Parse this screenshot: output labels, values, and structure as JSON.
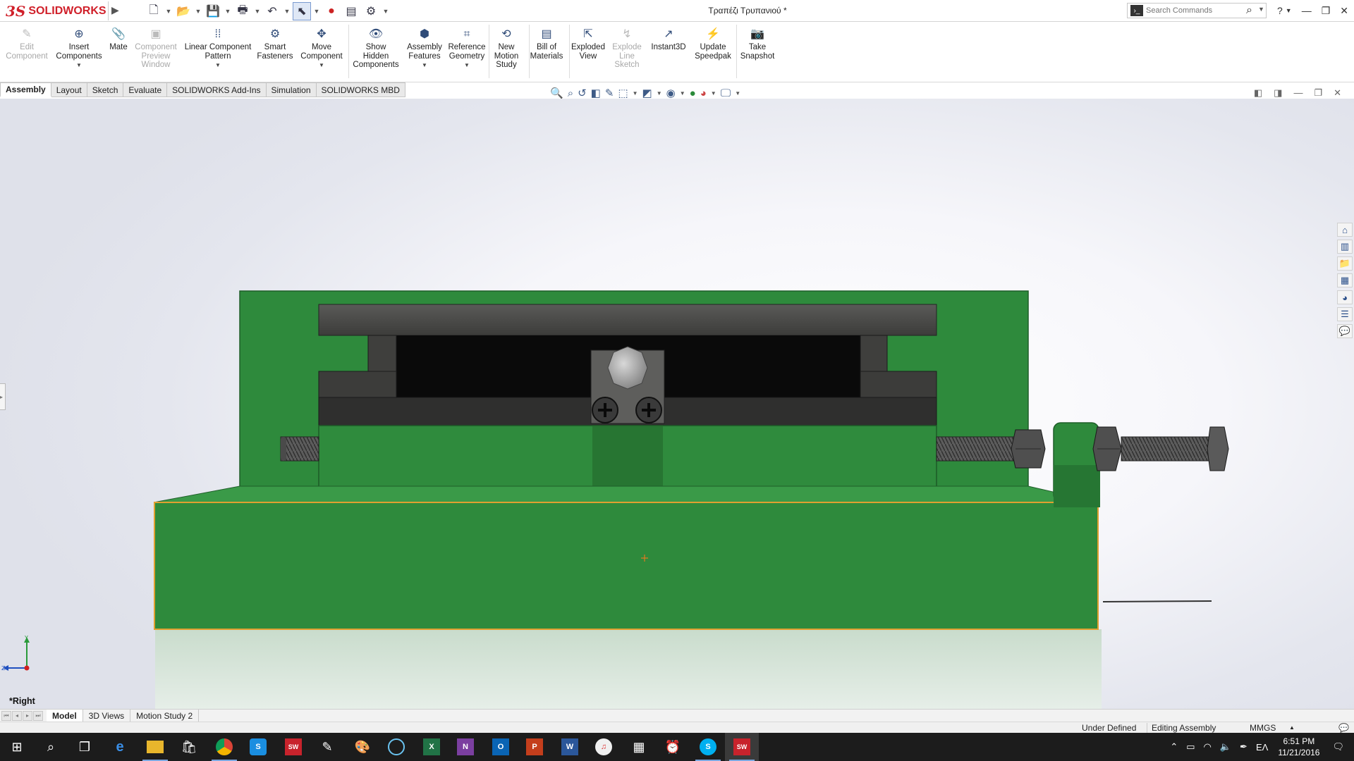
{
  "app": {
    "logo_ds": "3S",
    "logo_text": "SOLIDWORKS",
    "document_title": "Τραπέζι Τρυπανιού *"
  },
  "quick_access": {
    "icons": [
      "new-document-icon",
      "open-icon",
      "save-icon",
      "print-icon",
      "undo-icon",
      "select-icon",
      "rebuild-icon",
      "file-properties-icon",
      "options-icon"
    ]
  },
  "search": {
    "placeholder": "Search Commands"
  },
  "ribbon": {
    "commands": [
      {
        "id": "edit-component",
        "label": "Edit\nComponent",
        "enabled": false,
        "icon": "edit-component-icon",
        "dropdown": false
      },
      {
        "id": "insert-components",
        "label": "Insert\nComponents",
        "enabled": true,
        "icon": "insert-components-icon",
        "dropdown": true
      },
      {
        "id": "mate",
        "label": "Mate",
        "enabled": true,
        "icon": "paperclip-icon",
        "dropdown": false
      },
      {
        "id": "component-preview-window",
        "label": "Component\nPreview\nWindow",
        "enabled": false,
        "icon": "preview-window-icon",
        "dropdown": false
      },
      {
        "id": "linear-component-pattern",
        "label": "Linear Component\nPattern",
        "enabled": true,
        "icon": "linear-pattern-icon",
        "dropdown": true
      },
      {
        "id": "smart-fasteners",
        "label": "Smart\nFasteners",
        "enabled": true,
        "icon": "smart-fasteners-icon",
        "dropdown": false
      },
      {
        "id": "move-component",
        "label": "Move\nComponent",
        "enabled": true,
        "icon": "move-component-icon",
        "dropdown": true
      },
      {
        "id": "show-hidden-components",
        "label": "Show\nHidden\nComponents",
        "enabled": true,
        "icon": "show-hidden-icon",
        "dropdown": false
      },
      {
        "id": "assembly-features",
        "label": "Assembly\nFeatures",
        "enabled": true,
        "icon": "assembly-features-icon",
        "dropdown": true
      },
      {
        "id": "reference-geometry",
        "label": "Reference\nGeometry",
        "enabled": true,
        "icon": "reference-geometry-icon",
        "dropdown": true
      },
      {
        "id": "new-motion-study",
        "label": "New\nMotion\nStudy",
        "enabled": true,
        "icon": "motion-study-icon",
        "dropdown": false
      },
      {
        "id": "bill-of-materials",
        "label": "Bill of\nMaterials",
        "enabled": true,
        "icon": "bill-of-materials-icon",
        "dropdown": false
      },
      {
        "id": "exploded-view",
        "label": "Exploded\nView",
        "enabled": true,
        "icon": "exploded-view-icon",
        "dropdown": false
      },
      {
        "id": "explode-line-sketch",
        "label": "Explode\nLine\nSketch",
        "enabled": false,
        "icon": "explode-line-icon",
        "dropdown": false
      },
      {
        "id": "instant3d",
        "label": "Instant3D",
        "enabled": true,
        "icon": "instant3d-icon",
        "dropdown": false
      },
      {
        "id": "update-speedpak",
        "label": "Update\nSpeedpak",
        "enabled": true,
        "icon": "speedpak-icon",
        "dropdown": false
      },
      {
        "id": "take-snapshot",
        "label": "Take\nSnapshot",
        "enabled": true,
        "icon": "camera-icon",
        "dropdown": false
      }
    ]
  },
  "tabs": [
    {
      "label": "Assembly",
      "active": true
    },
    {
      "label": "Layout",
      "active": false
    },
    {
      "label": "Sketch",
      "active": false
    },
    {
      "label": "Evaluate",
      "active": false
    },
    {
      "label": "SOLIDWORKS Add-Ins",
      "active": false
    },
    {
      "label": "Simulation",
      "active": false
    },
    {
      "label": "SOLIDWORKS MBD",
      "active": false
    }
  ],
  "heads_up_toolbar": {
    "icons": [
      "zoom-to-fit-icon",
      "zoom-to-area-icon",
      "previous-view-icon",
      "section-view-icon",
      "dynamic-annotation-icon",
      "view-orientation-icon",
      "display-style-icon",
      "hide-show-items-icon",
      "edit-appearance-icon",
      "apply-scene-icon",
      "view-settings-icon"
    ]
  },
  "viewport": {
    "view_name": "*Right",
    "colors": {
      "green": "#2e8a3c",
      "green_dark": "#236c2e",
      "steel": "#4e4e4e",
      "selection_edge": "#e0a030"
    }
  },
  "task_pane": {
    "icons": [
      "home-icon",
      "design-library-icon",
      "file-explorer-icon",
      "view-palette-icon",
      "appearances-icon",
      "custom-properties-icon",
      "forum-icon"
    ]
  },
  "model_tabs": [
    {
      "label": "Model",
      "active": true
    },
    {
      "label": "3D Views",
      "active": false
    },
    {
      "label": "Motion Study 2",
      "active": false
    }
  ],
  "status_bar": {
    "definition": "Under Defined",
    "mode": "Editing Assembly",
    "units": "MMGS"
  },
  "taskbar": {
    "apps": [
      "start-icon",
      "search-icon",
      "task-view-icon",
      "edge-icon",
      "file-explorer-icon",
      "store-icon",
      "chrome-icon",
      "skype-business-icon",
      "solidworks-2016-icon",
      "edrawings-icon",
      "paint-icon",
      "media-icon",
      "excel-icon",
      "onenote-icon",
      "outlook-icon",
      "powerpoint-icon",
      "word-icon",
      "itunes-icon",
      "calculator-icon",
      "alarms-icon",
      "skype-icon",
      "solidworks-icon"
    ],
    "language": "ΕΛ",
    "time": "6:51 PM",
    "date": "11/21/2016"
  }
}
